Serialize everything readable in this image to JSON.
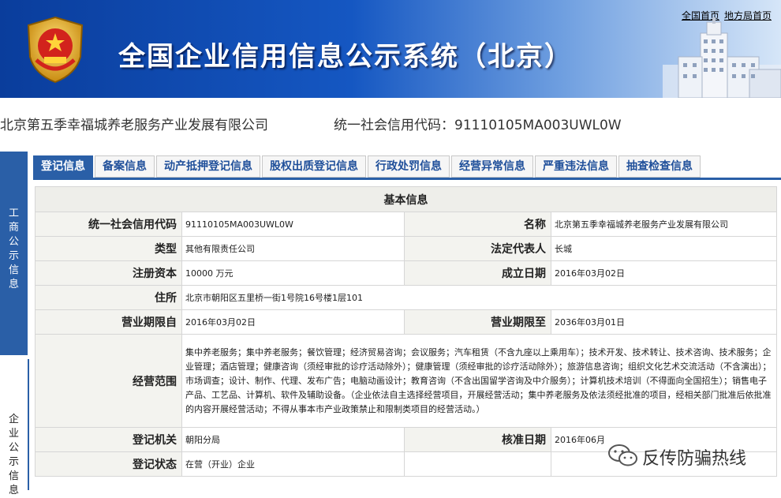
{
  "header": {
    "site_title": "全国企业信用信息公示系统（北京）",
    "links": [
      "全国首页",
      "地方局首页"
    ]
  },
  "company": {
    "name": "北京第五季幸福城养老服务产业发展有限公司",
    "credit_code_label": "统一社会信用代码：",
    "credit_code": "91110105MA003UWL0W"
  },
  "side_tabs": {
    "gongshang": "工商公示信息",
    "qiye": "企业公示信息"
  },
  "tabs": [
    "登记信息",
    "备案信息",
    "动产抵押登记信息",
    "股权出质登记信息",
    "行政处罚信息",
    "经营异常信息",
    "严重违法信息",
    "抽查检查信息"
  ],
  "basic_info": {
    "title": "基本信息",
    "credit_code_label": "统一社会信用代码",
    "credit_code": "91110105MA003UWL0W",
    "name_label": "名称",
    "name": "北京第五季幸福城养老服务产业发展有限公司",
    "type_label": "类型",
    "type": "其他有限责任公司",
    "legal_rep_label": "法定代表人",
    "legal_rep": "长城",
    "capital_label": "注册资本",
    "capital": "10000 万元",
    "founded_label": "成立日期",
    "founded": "2016年03月02日",
    "address_label": "住所",
    "address": "北京市朝阳区五里桥一街1号院16号楼1层101",
    "term_from_label": "营业期限自",
    "term_from": "2016年03月02日",
    "term_to_label": "营业期限至",
    "term_to": "2036年03月01日",
    "scope_label": "经营范围",
    "scope": "集中养老服务；集中养老服务；餐饮管理；经济贸易咨询；会议服务；汽车租赁（不含九座以上乘用车）；技术开发、技术转让、技术咨询、技术服务；企业管理；酒店管理；健康咨询（须经审批的诊疗活动除外）；健康管理（须经审批的诊疗活动除外）；旅游信息咨询；组织文化艺术交流活动（不含演出）；市场调查；设计、制作、代理、发布广告；电脑动画设计；教育咨询（不含出国留学咨询及中介服务）；计算机技术培训（不得面向全国招生）；销售电子产品、工艺品、计算机、软件及辅助设备。（企业依法自主选择经营项目，开展经营活动；集中养老服务及依法须经批准的项目，经相关部门批准后依批准的内容开展经营活动；不得从事本市产业政策禁止和限制类项目的经营活动。）",
    "authority_label": "登记机关",
    "authority": "朝阳分局",
    "approval_label": "核准日期",
    "approval": "2016年06月",
    "status_label": "登记状态",
    "status": "在营（开业）企业"
  },
  "watermark": {
    "text": "反传防骗热线"
  },
  "colors": {
    "header_blue": "#1557c2",
    "tab_blue": "#2a5fa7"
  }
}
